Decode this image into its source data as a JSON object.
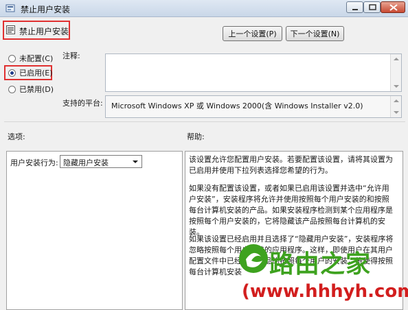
{
  "window": {
    "title": "禁止用户安装"
  },
  "header": {
    "policy_title": "禁止用户安装",
    "prev_button": "上一个设置(P)",
    "next_button": "下一个设置(N)"
  },
  "state": {
    "options": [
      {
        "label": "未配置(C)",
        "selected": false
      },
      {
        "label": "已启用(E)",
        "selected": true
      },
      {
        "label": "已禁用(D)",
        "selected": false
      }
    ]
  },
  "comment": {
    "label": "注释:",
    "value": ""
  },
  "platform": {
    "label": "支持的平台:",
    "value": "Microsoft Windows XP 或 Windows 2000(含 Windows Installer v2.0)"
  },
  "options_section": {
    "label": "选项:",
    "behavior_label": "用户安装行为:",
    "behavior_value": "隐藏用户安装"
  },
  "help_section": {
    "label": "帮助:",
    "paragraphs": [
      "该设置允许您配置用户安装。若要配置该设置，请将其设置为已启用并使用下拉列表选择您希望的行为。",
      "如果没有配置该设置，或者如果已启用该设置并选中“允许用户安装”，安装程序将允许并使用按照每个用户安装的和按照每台计算机安装的产品。如果安装程序检测到某个应用程序是按照每个用户安装的，它将隐藏该产品按照每台计算机的安装。",
      "如果该设置已经启用并且选择了“隐藏用户安装”，安装程序将忽略按照每个用户安装的应用程序。这样，即使用户在其用户配置文件中已经注册产品的按照每个用户的安装，将使得按照每台计算机安装"
    ]
  },
  "watermark": {
    "brand": "路由之家",
    "url": "(www.hhhyh.com)"
  },
  "colors": {
    "highlight_red": "#e03030",
    "watermark_green": "#3ea21f",
    "watermark_red": "#d21e1e"
  }
}
